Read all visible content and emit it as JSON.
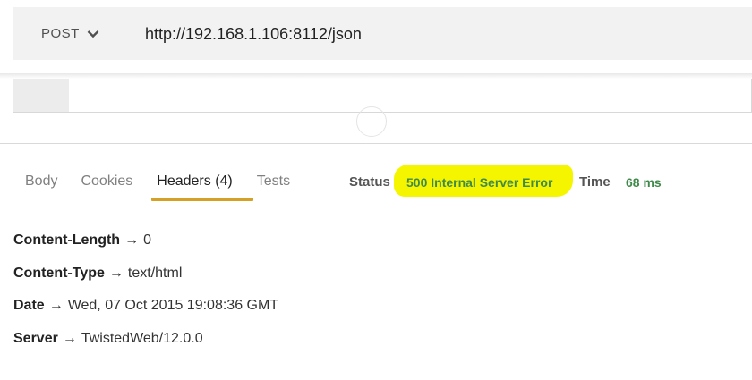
{
  "request": {
    "method": "POST",
    "url": "http://192.168.1.106:8112/json"
  },
  "icons": {
    "method_dropdown": "chevron-down-icon",
    "drag_handle": "circle-handle-icon"
  },
  "response": {
    "tabs": [
      {
        "label": "Body"
      },
      {
        "label": "Cookies"
      },
      {
        "label": "Headers (4)",
        "active": true
      },
      {
        "label": "Tests"
      }
    ],
    "status_label": "Status",
    "status_value": "500 Internal Server Error",
    "time_label": "Time",
    "time_value": "68 ms",
    "headers": [
      {
        "key": "Content-Length",
        "arrow": "→",
        "value": "0"
      },
      {
        "key": "Content-Type",
        "arrow": "→",
        "value": "text/html"
      },
      {
        "key": "Date",
        "arrow": "→",
        "value": "Wed, 07 Oct 2015 19:08:36 GMT"
      },
      {
        "key": "Server",
        "arrow": "→",
        "value": "TwistedWeb/12.0.0"
      }
    ]
  },
  "colors": {
    "active_tab_underline": "#d4a026",
    "status_highlight": "#f5f500",
    "status_text": "#3f8a4a"
  }
}
